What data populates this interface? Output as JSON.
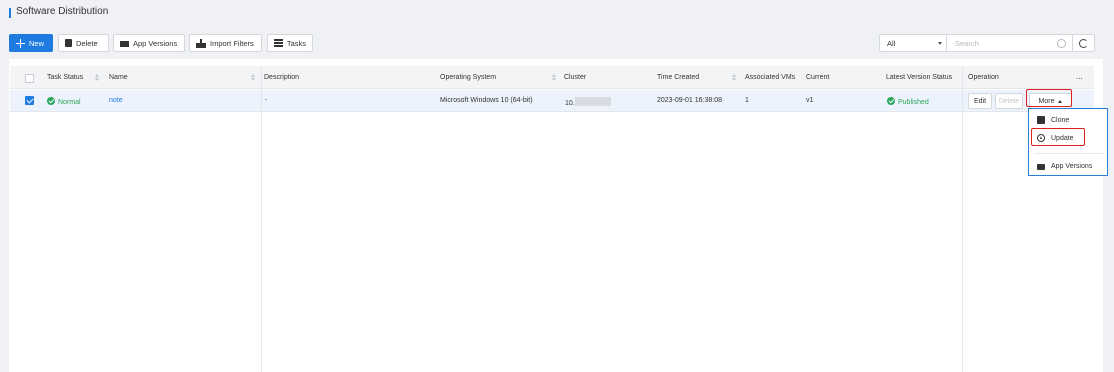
{
  "header": {
    "title": "Software Distribution"
  },
  "toolbar": {
    "new_label": "New",
    "delete_label": "Delete",
    "app_versions_label": "App Versions",
    "import_filters_label": "Import Filters",
    "tasks_label": "Tasks",
    "filter_value": "All",
    "search_placeholder": "Search"
  },
  "table": {
    "columns": [
      "Task Status",
      "Name",
      "Description",
      "Operating System",
      "Cluster",
      "Time Created",
      "Associated VMs",
      "Current",
      "Latest Version Status",
      "Operation"
    ],
    "more_columns_label": "...",
    "rows": [
      {
        "task_status": "Normal",
        "name": "note",
        "description": "-",
        "os": "Microsoft Windows 10 (64-bit)",
        "cluster": "10.",
        "time_created": "2023-09-01 16:38:08",
        "associated_vms": "1",
        "current": "v1",
        "latest_status": "Published",
        "edit_label": "Edit",
        "delete_label": "Delete",
        "more_label": "More"
      }
    ]
  },
  "more_menu": {
    "items": [
      {
        "label": "Clone",
        "icon": "copy-icon"
      },
      {
        "label": "Update",
        "icon": "upload-icon"
      },
      {
        "label": "App Versions",
        "icon": "box-icon"
      }
    ]
  },
  "colors": {
    "accent": "#1f7be0",
    "success": "#2aa65b",
    "highlight": "#e01f1f"
  }
}
